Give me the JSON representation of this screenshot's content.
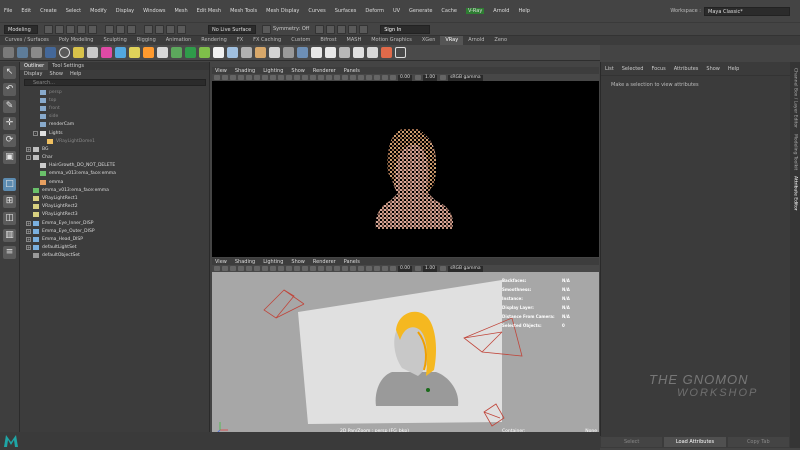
{
  "menubar": {
    "items": [
      "File",
      "Edit",
      "Create",
      "Select",
      "Modify",
      "Display",
      "Windows",
      "Mesh",
      "Edit Mesh",
      "Mesh Tools",
      "Mesh Display",
      "Curves",
      "Surfaces",
      "Deform",
      "UV",
      "Generate",
      "Cache",
      "V-Ray",
      "Arnold",
      "Help"
    ],
    "workspace_label": "Workspace :",
    "workspace_value": "Maya Classic*"
  },
  "statusline": {
    "mode": "Modeling",
    "live_surface": "No Live Surface",
    "symmetry": "Symmetry: Off",
    "sign_in": "Sign In"
  },
  "shelf_tabs": [
    "Curves / Surfaces",
    "Poly Modeling",
    "Sculpting",
    "Rigging",
    "Animation",
    "Rendering",
    "FX",
    "FX Caching",
    "Custom",
    "Bifrost",
    "MASH",
    "Motion Graphics",
    "XGen",
    "VRay",
    "Arnold",
    "Zeno"
  ],
  "shelf_active": "VRay",
  "outliner": {
    "tabs": [
      "Outliner",
      "Tool Settings"
    ],
    "menu": [
      "Display",
      "Show",
      "Help"
    ],
    "search_placeholder": "Search...",
    "items": [
      {
        "label": "persp",
        "indent": 1,
        "dim": true,
        "exp": ""
      },
      {
        "label": "top",
        "indent": 1,
        "dim": true,
        "exp": ""
      },
      {
        "label": "front",
        "indent": 1,
        "dim": true,
        "exp": ""
      },
      {
        "label": "side",
        "indent": 1,
        "dim": true,
        "exp": ""
      },
      {
        "label": "renderCam",
        "indent": 1,
        "dim": false,
        "exp": ""
      },
      {
        "label": "Lights",
        "indent": 1,
        "dim": false,
        "exp": "-"
      },
      {
        "label": "VRayLightDome1",
        "indent": 2,
        "dim": true,
        "exp": ""
      },
      {
        "label": "BG",
        "indent": 0,
        "dim": false,
        "exp": "+"
      },
      {
        "label": "Char",
        "indent": 0,
        "dim": false,
        "exp": "-"
      },
      {
        "label": "HairGrowth_DO_NOT_DELETE",
        "indent": 1,
        "dim": false,
        "exp": ""
      },
      {
        "label": "emma_v013:ema_face:emma",
        "indent": 1,
        "dim": false,
        "exp": ""
      },
      {
        "label": "emma",
        "indent": 1,
        "dim": false,
        "exp": ""
      },
      {
        "label": "emma_v013:ema_face:emma",
        "indent": 0,
        "dim": false,
        "exp": ""
      },
      {
        "label": "VRayLightRect1",
        "indent": 0,
        "dim": false,
        "exp": ""
      },
      {
        "label": "VRayLightRect2",
        "indent": 0,
        "dim": false,
        "exp": ""
      },
      {
        "label": "VRayLightRect3",
        "indent": 0,
        "dim": false,
        "exp": ""
      },
      {
        "label": "Emma_Eye_Inner_DISP",
        "indent": 0,
        "dim": false,
        "exp": "+"
      },
      {
        "label": "Emma_Eye_Outer_DISP",
        "indent": 0,
        "dim": false,
        "exp": "+"
      },
      {
        "label": "Emma_Head_DISP",
        "indent": 0,
        "dim": false,
        "exp": "+"
      },
      {
        "label": "defaultLightSet",
        "indent": 0,
        "dim": false,
        "exp": "+"
      },
      {
        "label": "defaultObjectSet",
        "indent": 0,
        "dim": false,
        "exp": ""
      }
    ]
  },
  "viewport": {
    "menu": [
      "View",
      "Shading",
      "Lighting",
      "Show",
      "Renderer",
      "Panels"
    ],
    "near": "0.00",
    "far": "1.00",
    "colorspace": "sRGB gamma"
  },
  "hud": [
    {
      "label": "Backfaces:",
      "value": "N/A"
    },
    {
      "label": "Smoothness:",
      "value": "N/A"
    },
    {
      "label": "Instance:",
      "value": "N/A"
    },
    {
      "label": "Display Layer:",
      "value": "N/A"
    },
    {
      "label": "Distance From Camera:",
      "value": "N/A"
    },
    {
      "label": "Selected Objects:",
      "value": "0"
    }
  ],
  "viewport_footer": {
    "camera": "2D Pan/Zoom : persp (FG_bkp)",
    "container_label": "Container:",
    "container_value": "None"
  },
  "attribute_editor": {
    "menu": [
      "List",
      "Selected",
      "Focus",
      "Attributes",
      "Show",
      "Help"
    ],
    "message": "Make a selection to view attributes",
    "buttons": [
      "Select",
      "Load Attributes",
      "Copy Tab"
    ],
    "side_tabs": [
      "Channel Box / Layer Editor",
      "Modeling Toolkit",
      "Attribute Editor"
    ]
  },
  "watermark": {
    "line1": "THE GNOMON",
    "line2": "WORKSHOP"
  },
  "colors": {
    "accent": "#5c8bb0",
    "hair": "#f5b820",
    "vray": "#2e7d32",
    "light_rect": "#c0453a"
  }
}
